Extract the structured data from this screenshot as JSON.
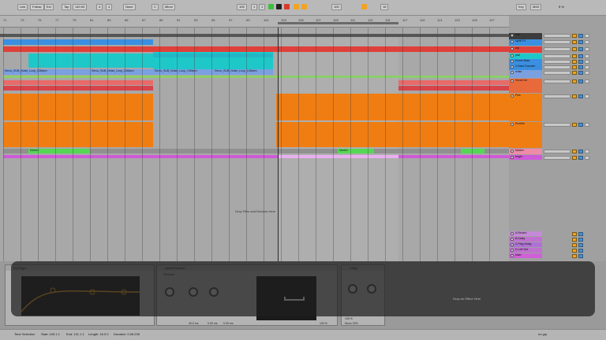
{
  "toolbar": {
    "link": "Link",
    "follow": "Follow",
    "ext": "Ext",
    "tap": "Tap",
    "tempo": "140.00",
    "meter_num": "4",
    "meter_den": "4",
    "quantize": "None",
    "key": "C",
    "scale": "Minor",
    "position": "105",
    "position_beat": "1",
    "position_sixteenth": "1",
    "loop_start": "100",
    "loop_len": "16",
    "key_label": "Key",
    "midi_label": "MIDI",
    "cpu": "5 %",
    "colors": {
      "play": "#3fbf3f",
      "record": "#d93a2a",
      "accent": "#f2a320"
    }
  },
  "ruler": {
    "bars": [
      "71",
      "73",
      "75",
      "77",
      "79",
      "81",
      "83",
      "85",
      "87",
      "89",
      "91",
      "93",
      "95",
      "97",
      "99",
      "101",
      "103",
      "105",
      "107",
      "109",
      "111",
      "113",
      "115",
      "117",
      "119",
      "121",
      "123",
      "125",
      "127"
    ]
  },
  "clips": {
    "row_audio_labels": [
      "Serco_SUB_Noise_Loop_136bpm",
      "Serco_SUB_Noise_Loop_136bpm",
      "Serco_SUB_Noise_Loop_136bpm",
      "Serco_SUB_Noise_Loop_136bpm"
    ],
    "marker_label": "Marker",
    "marker_label_2": "Marker"
  },
  "arrangement": {
    "drop_text": "Drop Files and Devices Here"
  },
  "tracks": [
    {
      "name": "sub",
      "color": "#3c3c3c"
    },
    {
      "name": "synth Fx",
      "color": "#3b8fe0"
    },
    {
      "name": "arp",
      "color": "#e0403a"
    },
    {
      "name": "pad",
      "color": "#1fc8c8"
    },
    {
      "name": "Drone Bass",
      "color": "#3b8fe0"
    },
    {
      "name": "4 Hand Sounder",
      "color": "#3b8fe0"
    },
    {
      "name": "noise",
      "color": "#7aa0e0"
    },
    {
      "name": "Vocal Cut",
      "color": "#e86a3a"
    },
    {
      "name": "Pink",
      "color": "#f07d12"
    },
    {
      "name": "Rumble",
      "color": "#f07d12"
    },
    {
      "name": "Marker",
      "color": "#ef8aa8"
    },
    {
      "name": "bright",
      "color": "#d05ad8"
    }
  ],
  "returns": [
    {
      "name": "A Reverb",
      "color": "#c48ad8"
    },
    {
      "name": "B Delay",
      "color": "#c070d0"
    },
    {
      "name": "C Ping Delay",
      "color": "#b070d8"
    },
    {
      "name": "D Left Slot",
      "color": "#c070d0"
    },
    {
      "name": "Main",
      "color": "#d060d8"
    }
  ],
  "track_controls": {
    "input_type": "Audio",
    "monitor": "Auto",
    "out": "Main",
    "volume": "0",
    "pan": "C"
  },
  "device": {
    "eq_title": "EQ Eight",
    "reverb_title": "Hybrid Reverb",
    "algo_label": "Shimmer",
    "decay": "40.0 ms",
    "predelay_1": "0.00 ms",
    "predelay_2": "0.00 ms",
    "predelay_3": "0.00 ms",
    "size_value": "100 %",
    "empty_text": "Drop an Effect Here",
    "utility_title": "Utility",
    "gain_value": "100 %",
    "width_value": "Mono 23%"
  },
  "statusbar": {
    "label": "Time Selection",
    "start": "Start: 105.1.1",
    "end": "End: 121.1.1",
    "length": "Length: 16.0.0",
    "duration": "Duration: 0:26:235",
    "right_label": "no grp"
  }
}
